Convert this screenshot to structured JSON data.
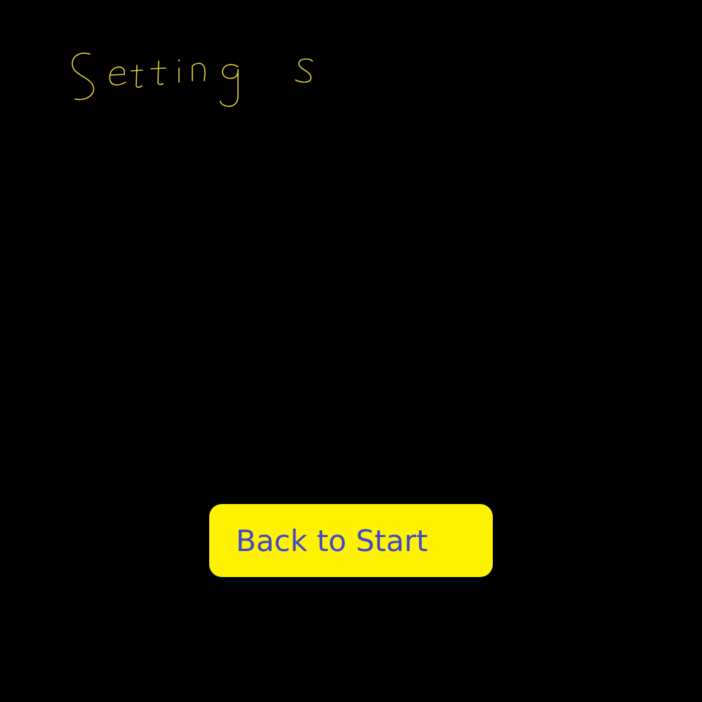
{
  "screen": {
    "title": "Settings"
  },
  "buttons": {
    "back_to_start": "Back to Start"
  },
  "colors": {
    "background": "#000000",
    "title_ink": "#e6d43a",
    "button_fill": "#fff200",
    "button_text": "#3f47cc"
  }
}
